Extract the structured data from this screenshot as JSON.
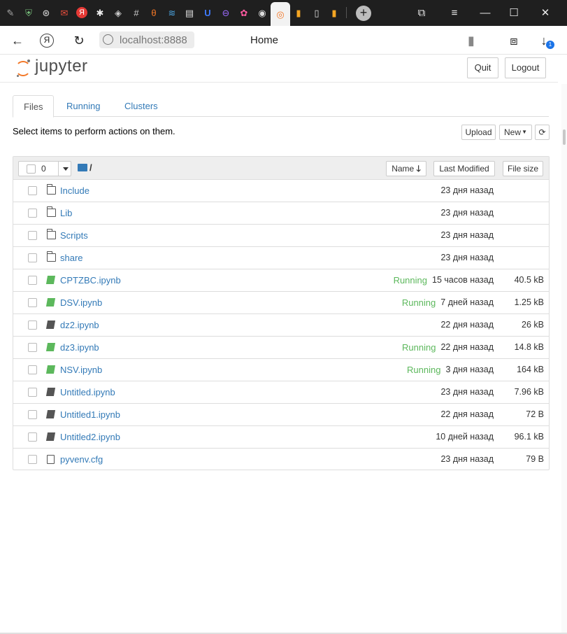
{
  "browser": {
    "tab_icons": [
      "pen-icon",
      "shield-icon",
      "circle-logo-icon",
      "mail-icon",
      "yandex-icon",
      "bug-icon",
      "crystal-icon",
      "hash-icon",
      "theta-icon",
      "stack-icon",
      "news-icon",
      "u-icon",
      "orbit-icon",
      "flower-icon",
      "github-icon",
      "jupyter-tab-icon",
      "book-orange-icon",
      "page-icon",
      "book-orange-icon"
    ],
    "address": "localhost:8888",
    "page_title": "Home",
    "download_badge": "1"
  },
  "header": {
    "logo_text": "jupyter",
    "quit_label": "Quit",
    "logout_label": "Logout"
  },
  "tabs": [
    {
      "label": "Files",
      "active": true
    },
    {
      "label": "Running",
      "active": false
    },
    {
      "label": "Clusters",
      "active": false
    }
  ],
  "toolbar": {
    "hint": "Select items to perform actions on them.",
    "upload_label": "Upload",
    "new_label": "New",
    "refresh_icon": "refresh-icon"
  },
  "list_header": {
    "selected_count": "0",
    "path": "/",
    "name_col": "Name",
    "modified_col": "Last Modified",
    "size_col": "File size"
  },
  "files": [
    {
      "name": "Include",
      "type": "folder",
      "status": "",
      "modified": "23 дня назад",
      "size": ""
    },
    {
      "name": "Lib",
      "type": "folder",
      "status": "",
      "modified": "23 дня назад",
      "size": ""
    },
    {
      "name": "Scripts",
      "type": "folder",
      "status": "",
      "modified": "23 дня назад",
      "size": ""
    },
    {
      "name": "share",
      "type": "folder",
      "status": "",
      "modified": "23 дня назад",
      "size": ""
    },
    {
      "name": "CPTZBC.ipynb",
      "type": "notebook-running",
      "status": "Running",
      "modified": "15 часов назад",
      "size": "40.5 kB"
    },
    {
      "name": "DSV.ipynb",
      "type": "notebook-running",
      "status": "Running",
      "modified": "7 дней назад",
      "size": "1.25 kB"
    },
    {
      "name": "dz2.ipynb",
      "type": "notebook",
      "status": "",
      "modified": "22 дня назад",
      "size": "26 kB"
    },
    {
      "name": "dz3.ipynb",
      "type": "notebook-running",
      "status": "Running",
      "modified": "22 дня назад",
      "size": "14.8 kB"
    },
    {
      "name": "NSV.ipynb",
      "type": "notebook-running",
      "status": "Running",
      "modified": "3 дня назад",
      "size": "164 kB"
    },
    {
      "name": "Untitled.ipynb",
      "type": "notebook",
      "status": "",
      "modified": "23 дня назад",
      "size": "7.96 kB"
    },
    {
      "name": "Untitled1.ipynb",
      "type": "notebook",
      "status": "",
      "modified": "22 дня назад",
      "size": "72 B"
    },
    {
      "name": "Untitled2.ipynb",
      "type": "notebook",
      "status": "",
      "modified": "10 дней назад",
      "size": "96.1 kB"
    },
    {
      "name": "pyvenv.cfg",
      "type": "file",
      "status": "",
      "modified": "23 дня назад",
      "size": "79 B"
    }
  ],
  "colors": {
    "link": "#337ab7",
    "running": "#5cb85c",
    "jupyter_orange": "#f37726"
  }
}
